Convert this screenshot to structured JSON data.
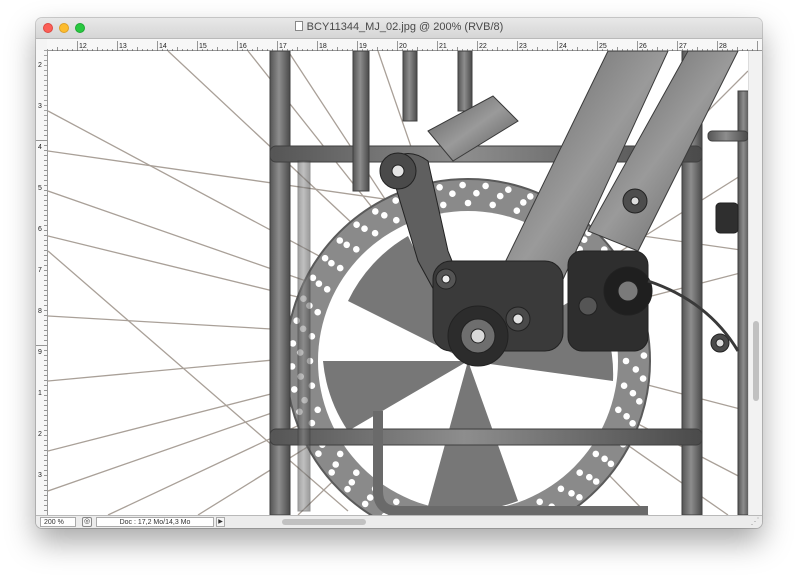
{
  "window": {
    "title": "BCY11344_MJ_02.jpg @ 200% (RVB/8)"
  },
  "rulers": {
    "horizontal_ticks": [
      "12",
      "13",
      "14",
      "15",
      "16",
      "17",
      "18",
      "19",
      "20",
      "21",
      "22",
      "23",
      "24",
      "25",
      "26",
      "27",
      "28"
    ],
    "vertical_ticks": [
      "2",
      "3",
      "4",
      "5",
      "6",
      "7",
      "8",
      "9",
      "1",
      "2",
      "3"
    ]
  },
  "statusbar": {
    "zoom": "200 %",
    "doc_info": "Doc : 17,2 Mo/14,3 Mo"
  },
  "image": {
    "subject": "bicycle front wheel disc brake with rack",
    "colors": {
      "frame": "#6b6b6b",
      "rotor": "#8a8a8a",
      "spoke": "#9a9088",
      "dark": "#2e2e2e"
    }
  }
}
